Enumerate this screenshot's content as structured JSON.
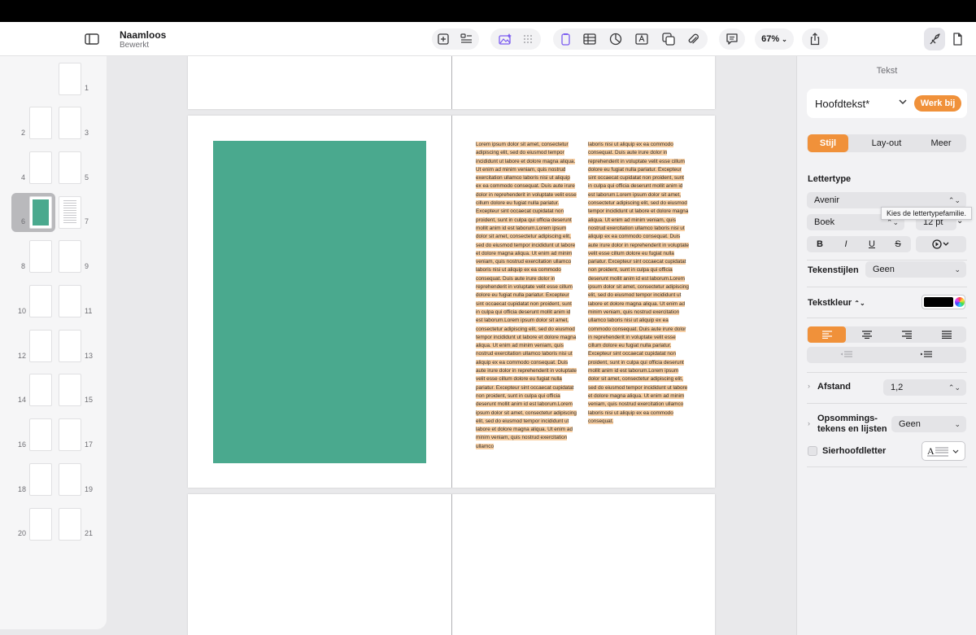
{
  "document": {
    "title": "Naamloos",
    "subtitle": "Bewerkt"
  },
  "toolbar": {
    "zoom": "67%",
    "icons": [
      "sidebar-toggle-icon",
      "add-page-icon",
      "format-list-icon",
      "media-icon",
      "grid-icon",
      "text-box-icon",
      "table-icon",
      "chart-icon",
      "textfield-icon",
      "shape-icon",
      "attachment-icon",
      "comment-icon",
      "share-icon",
      "format-brush-icon",
      "document-icon"
    ]
  },
  "thumbnails": {
    "pages": [
      "1",
      "2",
      "3",
      "4",
      "5",
      "6",
      "7",
      "8",
      "9",
      "10",
      "11",
      "12",
      "13",
      "14",
      "15",
      "16",
      "17",
      "18",
      "19",
      "20",
      "21"
    ],
    "selected": "6"
  },
  "body_text": {
    "left_column": "Lorem ipsum dolor sit amet, consectetur adipiscing elit, sed do eiusmod tempor incididunt ut labore et dolore magna aliqua. Ut enim ad minim veniam, quis nostrud exercitation ullamco laboris nisi ut aliquip ex ea commodo consequat. Duis aute irure dolor in reprehenderit in voluptate velit esse cillum dolore eu fugiat nulla pariatur. Excepteur sint occaecat cupidatat non proident, sunt in culpa qui officia deserunt mollit anim id est laborum.Lorem ipsum dolor sit amet, consectetur adipiscing elit, sed do eiusmod tempor incididunt ut labore et dolore magna aliqua. Ut enim ad minim veniam, quis nostrud exercitation ullamco laboris nisi ut aliquip ex ea commodo consequat. Duis aute irure dolor in reprehenderit in voluptate velit esse cillum dolore eu fugiat nulla pariatur. Excepteur sint occaecat cupidatat non proident, sunt in culpa qui officia deserunt mollit anim id est laborum.Lorem ipsum dolor sit amet, consectetur adipiscing elit, sed do eiusmod tempor incididunt ut labore et dolore magna aliqua. Ut enim ad minim veniam, quis nostrud exercitation ullamco laboris nisi ut aliquip ex ea commodo consequat. Duis aute irure dolor in reprehenderit in voluptate velit esse cillum dolore eu fugiat nulla pariatur. Excepteur sint occaecat cupidatat non proident, sunt in culpa qui officia deserunt mollit anim id est laborum.Lorem ipsum dolor sit amet, consectetur adipiscing elit, sed do eiusmod tempor incididunt ut labore et dolore magna aliqua. Ut enim ad minim veniam, quis nostrud exercitation ullamco",
    "right_column": "laboris nisi ut aliquip ex ea commodo consequat. Duis aute irure dolor in reprehenderit in voluptate velit esse cillum dolore eu fugiat nulla pariatur. Excepteur sint occaecat cupidatat non proident, sunt in culpa qui officia deserunt mollit anim id est laborum.Lorem ipsum dolor sit amet, consectetur adipiscing elit, sed do eiusmod tempor incididunt ut labore et dolore magna aliqua. Ut enim ad minim veniam, quis nostrud exercitation ullamco laboris nisi ut aliquip ex ea commodo consequat. Duis aute irure dolor in reprehenderit in voluptate velit esse cillum dolore eu fugiat nulla pariatur. Excepteur sint occaecat cupidatat non proident, sunt in culpa qui officia deserunt mollit anim id est laborum.Lorem ipsum dolor sit amet, consectetur adipiscing elit, sed do eiusmod tempor incididunt ut labore et dolore magna aliqua. Ut enim ad minim veniam, quis nostrud exercitation ullamco laboris nisi ut aliquip ex ea commodo consequat. Duis aute irure dolor in reprehenderit in voluptate velit esse cillum dolore eu fugiat nulla pariatur. Excepteur sint occaecat cupidatat non proident, sunt in culpa qui officia deserunt mollit anim id est laborum.Lorem ipsum dolor sit amet, consectetur adipiscing elit, sed do eiusmod tempor incididunt ut labore et dolore magna aliqua. Ut enim ad minim veniam, quis nostrud exercitation ullamco laboris nisi ut aliquip ex ea commodo consequat."
  },
  "inspector": {
    "title": "Tekst",
    "paragraph_style": "Hoofdtekst*",
    "update_label": "Werk bij",
    "tabs": [
      "Stijl",
      "Lay-out",
      "Meer"
    ],
    "active_tab": "Stijl",
    "font_section": "Lettertype",
    "font_family": "Avenir",
    "font_tooltip": "Kies de lettertypefamilie.",
    "font_weight": "Boek",
    "font_size": "12 pt",
    "format_buttons": [
      "B",
      "I",
      "U",
      "S"
    ],
    "char_styles_label": "Tekenstijlen",
    "char_styles_value": "Geen",
    "text_color_label": "Tekstkleur",
    "text_color": "#000000",
    "spacing_label": "Afstand",
    "spacing_value": "1,2",
    "bullets_label_1": "Opsommings-",
    "bullets_label_2": "tekens en lijsten",
    "bullets_value": "Geen",
    "dropcap_label": "Sierhoofdletter",
    "alignment": "left"
  },
  "colors": {
    "accent": "#f0913a",
    "image_fill": "#4aa98e",
    "highlight": "#f8cfa3"
  }
}
